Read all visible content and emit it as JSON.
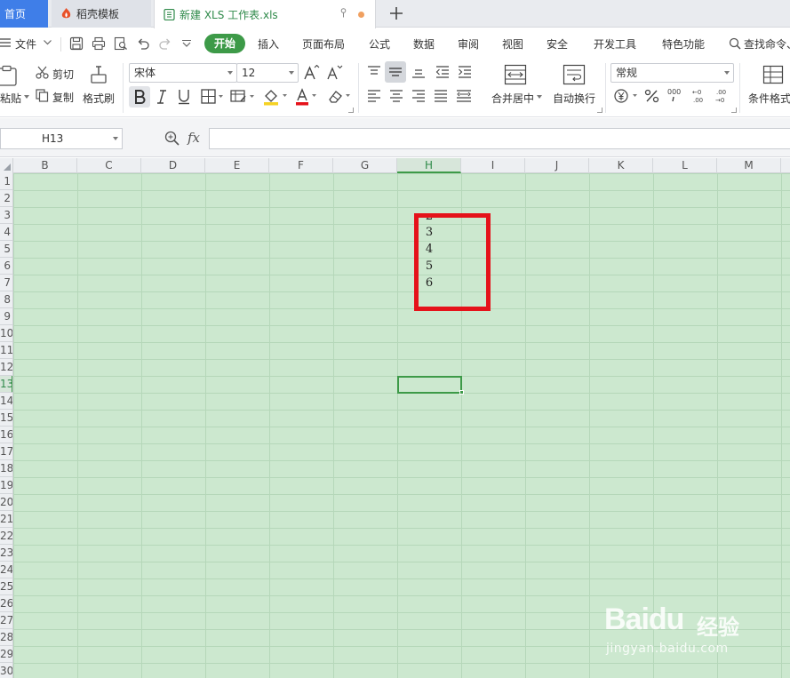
{
  "tabs": {
    "home": "首页",
    "template": "稻壳模板",
    "file": "新建 XLS 工作表.xls"
  },
  "menu": {
    "file": "文件",
    "kaishi": "开始",
    "items": [
      "插入",
      "页面布局",
      "公式",
      "数据",
      "审阅",
      "视图",
      "安全",
      "开发工具",
      "特色功能"
    ],
    "search": "查找命令、"
  },
  "ribbon": {
    "paste": "粘贴",
    "cut": "剪切",
    "copy": "复制",
    "format_painter": "格式刷",
    "font_name": "宋体",
    "font_size": "12",
    "merge_center": "合并居中",
    "wrap_text": "自动换行",
    "number_format": "常规",
    "cond_format": "条件格式"
  },
  "formula_bar": {
    "cell_ref": "H13",
    "fx": "fx",
    "content": ""
  },
  "columns": [
    "B",
    "C",
    "D",
    "E",
    "F",
    "G",
    "H",
    "I",
    "J",
    "K",
    "L",
    "M"
  ],
  "active_column": "H",
  "rows": [
    "1",
    "2",
    "3",
    "4",
    "5",
    "6",
    "7",
    "8",
    "9",
    "10",
    "11",
    "12",
    "13",
    "14",
    "15",
    "16",
    "17",
    "18",
    "19",
    "20",
    "21",
    "22",
    "23",
    "24",
    "25",
    "26",
    "27",
    "28",
    "29",
    "30"
  ],
  "active_row": "13",
  "cells": [
    {
      "ref": "H3",
      "value": "2"
    },
    {
      "ref": "H4",
      "value": "3"
    },
    {
      "ref": "H5",
      "value": "4"
    },
    {
      "ref": "H6",
      "value": "5"
    },
    {
      "ref": "H7",
      "value": "6"
    }
  ],
  "watermark": {
    "brand": "Baidu",
    "cn": "经验",
    "url": "jingyan.baidu.com"
  },
  "colors": {
    "accent_green": "#3d9a48",
    "grid_bg": "#cce8cf",
    "highlight_red": "#e5121a",
    "home_tab_blue": "#3f7ee8"
  }
}
